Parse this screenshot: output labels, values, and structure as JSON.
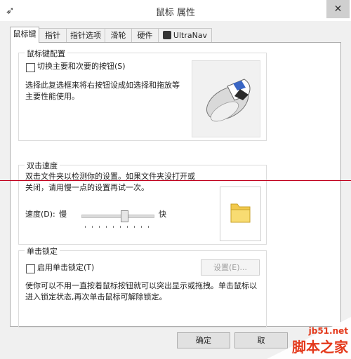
{
  "window": {
    "title": "鼠标 属性",
    "close_glyph": "✕"
  },
  "tabs": [
    "鼠标键",
    "指针",
    "指针选项",
    "滑轮",
    "硬件",
    "UltraNav"
  ],
  "button_config": {
    "title": "鼠标键配置",
    "switch_label": "切换主要和次要的按钮(S)",
    "description": "选择此复选框来将右按钮设成如选择和拖放等主要性能使用。"
  },
  "double_click": {
    "title": "双击速度",
    "description": "双击文件夹以检测你的设置。如果文件夹没打开或关闭，请用慢一点的设置再试一次。",
    "speed_label": "速度(D):",
    "slow": "慢",
    "fast": "快",
    "speed_value": 0.6
  },
  "click_lock": {
    "title": "单击锁定",
    "enable_label": "启用单击锁定(T)",
    "settings_button": "设置(E)...",
    "description": "使你可以不用一直按着鼠标按钮就可以突出显示或拖拽。单击鼠标以进入锁定状态,再次单击鼠标可解除锁定。"
  },
  "footer": {
    "ok": "确定",
    "cancel": "取"
  },
  "watermark": {
    "url": "jb51.net",
    "name": "脚本之家"
  }
}
